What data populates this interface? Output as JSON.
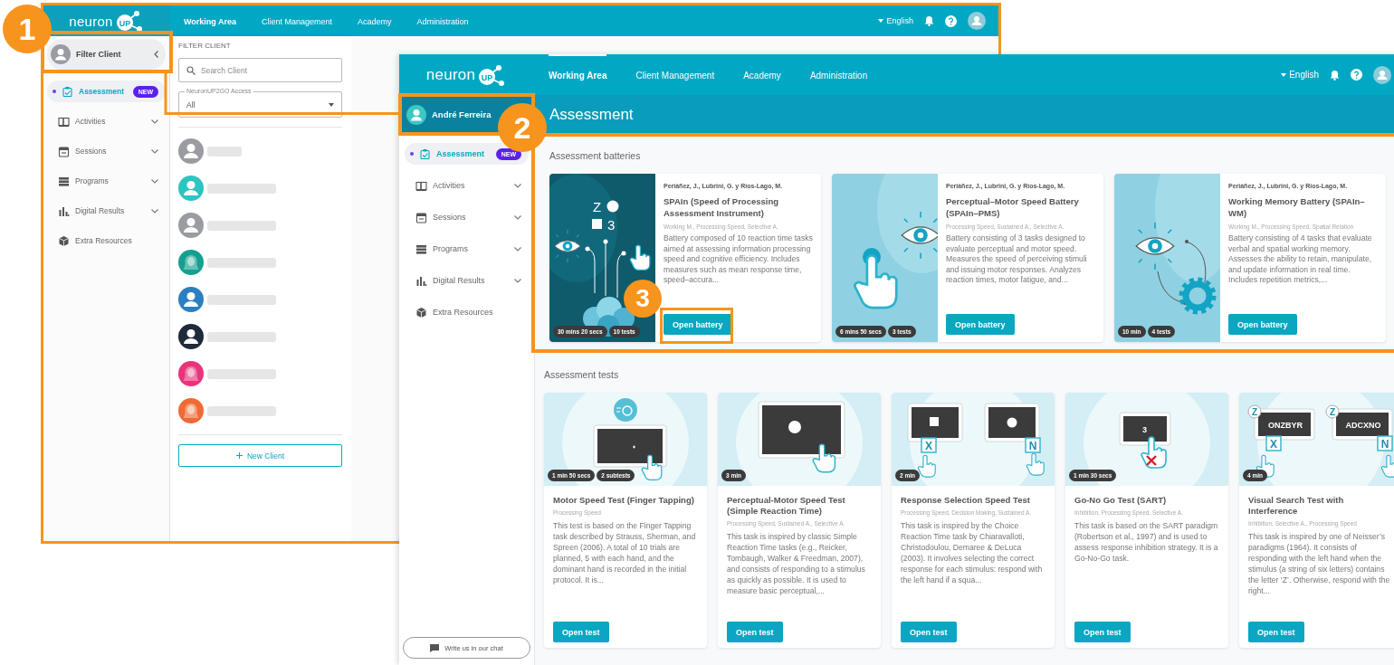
{
  "back_window": {
    "logo": {
      "text": "neuron",
      "mark": "UP"
    },
    "nav": [
      {
        "label": "Working Area",
        "selected": true
      },
      {
        "label": "Client Management",
        "selected": false
      },
      {
        "label": "Academy",
        "selected": false
      },
      {
        "label": "Administration",
        "selected": false
      }
    ],
    "language": "English",
    "sidebar": {
      "client": "Filter Client",
      "items": [
        {
          "label": "Assessment",
          "kind": "assessment",
          "selected": true,
          "expandable": false,
          "badge": "NEW"
        },
        {
          "label": "Activities",
          "kind": "activities",
          "selected": false,
          "expandable": true
        },
        {
          "label": "Sessions",
          "kind": "sessions",
          "selected": false,
          "expandable": true
        },
        {
          "label": "Programs",
          "kind": "programs",
          "selected": false,
          "expandable": true
        },
        {
          "label": "Digital Results",
          "kind": "results",
          "selected": false,
          "expandable": true
        },
        {
          "label": "Extra Resources",
          "kind": "resources",
          "selected": false,
          "expandable": false
        }
      ]
    },
    "filter_panel": {
      "title": "FILTER CLIENT",
      "search": {
        "placeholder": "Search Client"
      },
      "access": {
        "label": "NeuronUP2GO Access",
        "value": "All"
      },
      "clients": [
        {
          "kind": "person",
          "color": "#9a9ca1"
        },
        {
          "kind": "person",
          "color": "#2ec4c0"
        },
        {
          "kind": "person",
          "color": "#9a9ca1"
        },
        {
          "kind": "woman",
          "color": "#14a08e"
        },
        {
          "kind": "person",
          "color": "#2b7fc0"
        },
        {
          "kind": "person",
          "color": "#1f2b3a"
        },
        {
          "kind": "woman",
          "color": "#e8347a"
        },
        {
          "kind": "woman",
          "color": "#f06a35"
        }
      ],
      "new_client": "New Client"
    }
  },
  "front_window": {
    "logo": {
      "text": "neuron",
      "mark": "UP"
    },
    "nav": [
      {
        "label": "Working Area",
        "selected": true
      },
      {
        "label": "Client Management",
        "selected": false
      },
      {
        "label": "Academy",
        "selected": false
      },
      {
        "label": "Administration",
        "selected": false
      }
    ],
    "language": "English",
    "sidebar": {
      "client": "André Ferreira",
      "items": [
        {
          "label": "Assessment",
          "kind": "assessment",
          "selected": true,
          "expandable": false,
          "badge": "NEW"
        },
        {
          "label": "Activities",
          "kind": "activities",
          "selected": false,
          "expandable": true
        },
        {
          "label": "Sessions",
          "kind": "sessions",
          "selected": false,
          "expandable": true
        },
        {
          "label": "Programs",
          "kind": "programs",
          "selected": false,
          "expandable": true
        },
        {
          "label": "Digital Results",
          "kind": "results",
          "selected": false,
          "expandable": true
        },
        {
          "label": "Extra Resources",
          "kind": "resources",
          "selected": false,
          "expandable": false
        }
      ],
      "chat": "Write us in our chat"
    },
    "page_title": "Assessment",
    "batteries": {
      "heading": "Assessment batteries",
      "cards": [
        {
          "authors": "Periáñez, J., Lubrini, G. y Ríos-Lago, M.",
          "title": "SPAIn (Speed of Processing Assessment Instrument)",
          "tags": "Working M., Processing Speed, Selective A.",
          "description": "Battery composed of 10 reaction time tasks aimed at assessing information processing speed and cognitive efficiency. Includes measures such as mean response time, speed–accura...",
          "button": "Open battery",
          "badges": [
            "30 mins 20 secs",
            "10 tests"
          ],
          "art": {
            "kind": "processing",
            "glyphs": [
              "Z",
              "3"
            ]
          }
        },
        {
          "authors": "Periáñez, J., Lubrini, G. y Ríos-Lago, M.",
          "title": "Perceptual–Motor Speed Battery (SPAIn–PMS)",
          "tags": "Processing Speed, Sustained A., Selective A.",
          "description": "Battery consisting of 3 tasks designed to evaluate perceptual and motor speed. Measures the speed of perceiving stimuli and issuing motor responses. Analyzes reaction times, motor fatigue, and...",
          "button": "Open battery",
          "badges": [
            "6 mins 50 secs",
            "3 tests"
          ],
          "art": {
            "kind": "motor"
          }
        },
        {
          "authors": "Periáñez, J., Lubrini, G. y Ríos-Lago, M.",
          "title": "Working Memory Battery (SPAIn–WM)",
          "tags": "Working M., Processing Speed, Spatial Relation",
          "description": "Battery consisting of 4 tasks that evaluate verbal and spatial working memory. Assesses the ability to retain, manipulate, and update information in real time. Includes repetition metrics,...",
          "button": "Open battery",
          "badges": [
            "10 min",
            "4 tests"
          ],
          "art": {
            "kind": "memory"
          }
        }
      ]
    },
    "tests": {
      "heading": "Assessment tests",
      "cards": [
        {
          "title": "Motor Speed Test (Finger Tapping)",
          "tags": "Processing Speed",
          "description": "This test is based on the Finger Tapping task described by Strauss, Sherman, and Spreen (2006). A total of 10 trials are planned, 5 with each hand, and the dominant hand is recorded in the initial protocol. It is...",
          "button": "Open test",
          "badges": [
            "1 min 50 secs",
            "2 subtests"
          ],
          "art": {
            "kind": "tapping"
          }
        },
        {
          "title": "Perceptual-Motor Speed Test (Simple Reaction Time)",
          "tags": "Processing Speed, Sustained A., Selective A.",
          "description": "This task is inspired by classic Simple Reaction Time tasks (e.g., Reicker, Tombaugh, Walker & Freedman, 2007), and consists of responding to a stimulus as quickly as possible. It is used to measure basic perceptual,...",
          "button": "Open test",
          "badges": [
            "3 min"
          ],
          "art": {
            "kind": "reaction"
          }
        },
        {
          "title": "Response Selection Speed Test",
          "tags": "Processing Speed, Decision Making, Sustained A.",
          "description": "This task is inspired by the Choice Reaction Time task by Chiaravalloti, Christodoulou, Demaree & DeLuca (2003). It involves selecting the correct response for each stimulus: respond with the left hand if a squa...",
          "button": "Open test",
          "badges": [
            "2 min"
          ],
          "art": {
            "kind": "choice",
            "keys": [
              "X",
              "N"
            ]
          }
        },
        {
          "title": "Go-No Go Test (SART)",
          "tags": "Inhibition, Processing Speed, Selective A.",
          "description": "This task is based on the SART paradigm (Robertson et al., 1997) and is used to assess response inhibition strategy. It is a Go-No-Go task.",
          "button": "Open test",
          "badges": [
            "1 min 30 secs"
          ],
          "art": {
            "kind": "gonogo",
            "screen": "3"
          }
        },
        {
          "title": "Visual Search Test with Interference",
          "tags": "Inhibition, Selective A., Processing Speed",
          "description": "This task is inspired by one of Neisser’s paradigms (1964). It consists of responding with the left hand when the stimulus (a string of six letters) contains the letter ‘Z’. Otherwise, respond with the right...",
          "button": "Open test",
          "badges": [
            "4 min"
          ],
          "art": {
            "kind": "search",
            "screens": [
              {
                "text": "ONZBYR",
                "key": "X",
                "target": "Z"
              },
              {
                "text": "ADCXNO",
                "key": "N",
                "target": "Z"
              }
            ]
          }
        }
      ]
    }
  },
  "callouts": [
    {
      "number": "1"
    },
    {
      "number": "2"
    },
    {
      "number": "3"
    }
  ]
}
